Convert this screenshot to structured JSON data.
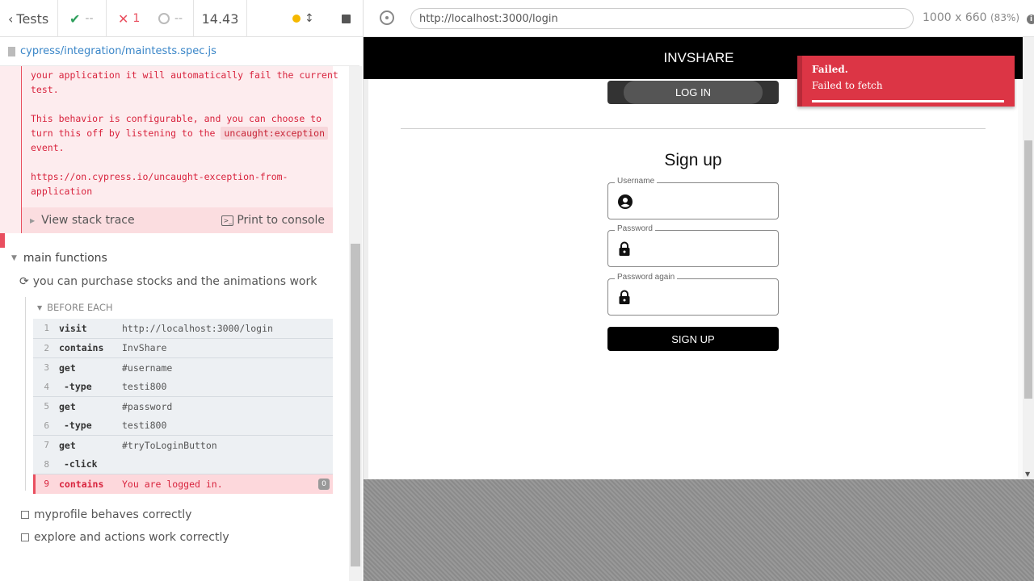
{
  "topbar": {
    "tests_label": "Tests",
    "passed": "--",
    "failed": "1",
    "pending": "--",
    "duration": "14.43"
  },
  "spec": {
    "path": "cypress/integration/maintests.spec.js"
  },
  "error": {
    "lines_top": "your application it will automatically fail the current\ntest.",
    "line_config_1": "This behavior is configurable, and you can choose to",
    "line_config_2a": "turn this off by listening to the ",
    "code_pill": "uncaught:exception",
    "line_config_3": "event.",
    "link_1": "https://on.cypress.io/uncaught-exception-from-",
    "link_2": "application",
    "stack_label": "View stack trace",
    "print_label": "Print to console"
  },
  "suite": {
    "title": "main functions",
    "test_title": "you can purchase stocks and the animations work",
    "hook_label": "BEFORE EACH",
    "commands": [
      {
        "num": "1",
        "name": "visit",
        "msg": "http://localhost:3000/login"
      },
      {
        "num": "2",
        "name": "contains",
        "msg": "InvShare"
      },
      {
        "num": "3",
        "name": "get",
        "msg": "#username"
      },
      {
        "num": "4",
        "name": "-type",
        "msg": "testi800"
      },
      {
        "num": "5",
        "name": "get",
        "msg": "#password"
      },
      {
        "num": "6",
        "name": "-type",
        "msg": "testi800"
      },
      {
        "num": "7",
        "name": "get",
        "msg": "#tryToLoginButton"
      },
      {
        "num": "8",
        "name": "-click",
        "msg": ""
      },
      {
        "num": "9",
        "name": "contains",
        "msg": "You are logged in."
      }
    ],
    "fail_badge": "0",
    "other_tests": [
      "myprofile behaves correctly",
      "explore and actions work correctly"
    ]
  },
  "browser": {
    "url": "http://localhost:3000/login",
    "viewport": "1000 x 660",
    "zoom": "(83%)"
  },
  "app": {
    "brand": "INVSHARE",
    "login_button": "LOG IN",
    "signup_title": "Sign up",
    "username_label": "Username",
    "password_label": "Password",
    "password_again_label": "Password again",
    "signup_button": "SIGN UP"
  },
  "toast": {
    "title": "Failed.",
    "message": "Failed to fetch"
  },
  "colors": {
    "error": "#e94f5f",
    "toast": "#dc3545",
    "link": "#3a86c8",
    "pass": "#2e9f5c",
    "running": "#f5b800"
  }
}
